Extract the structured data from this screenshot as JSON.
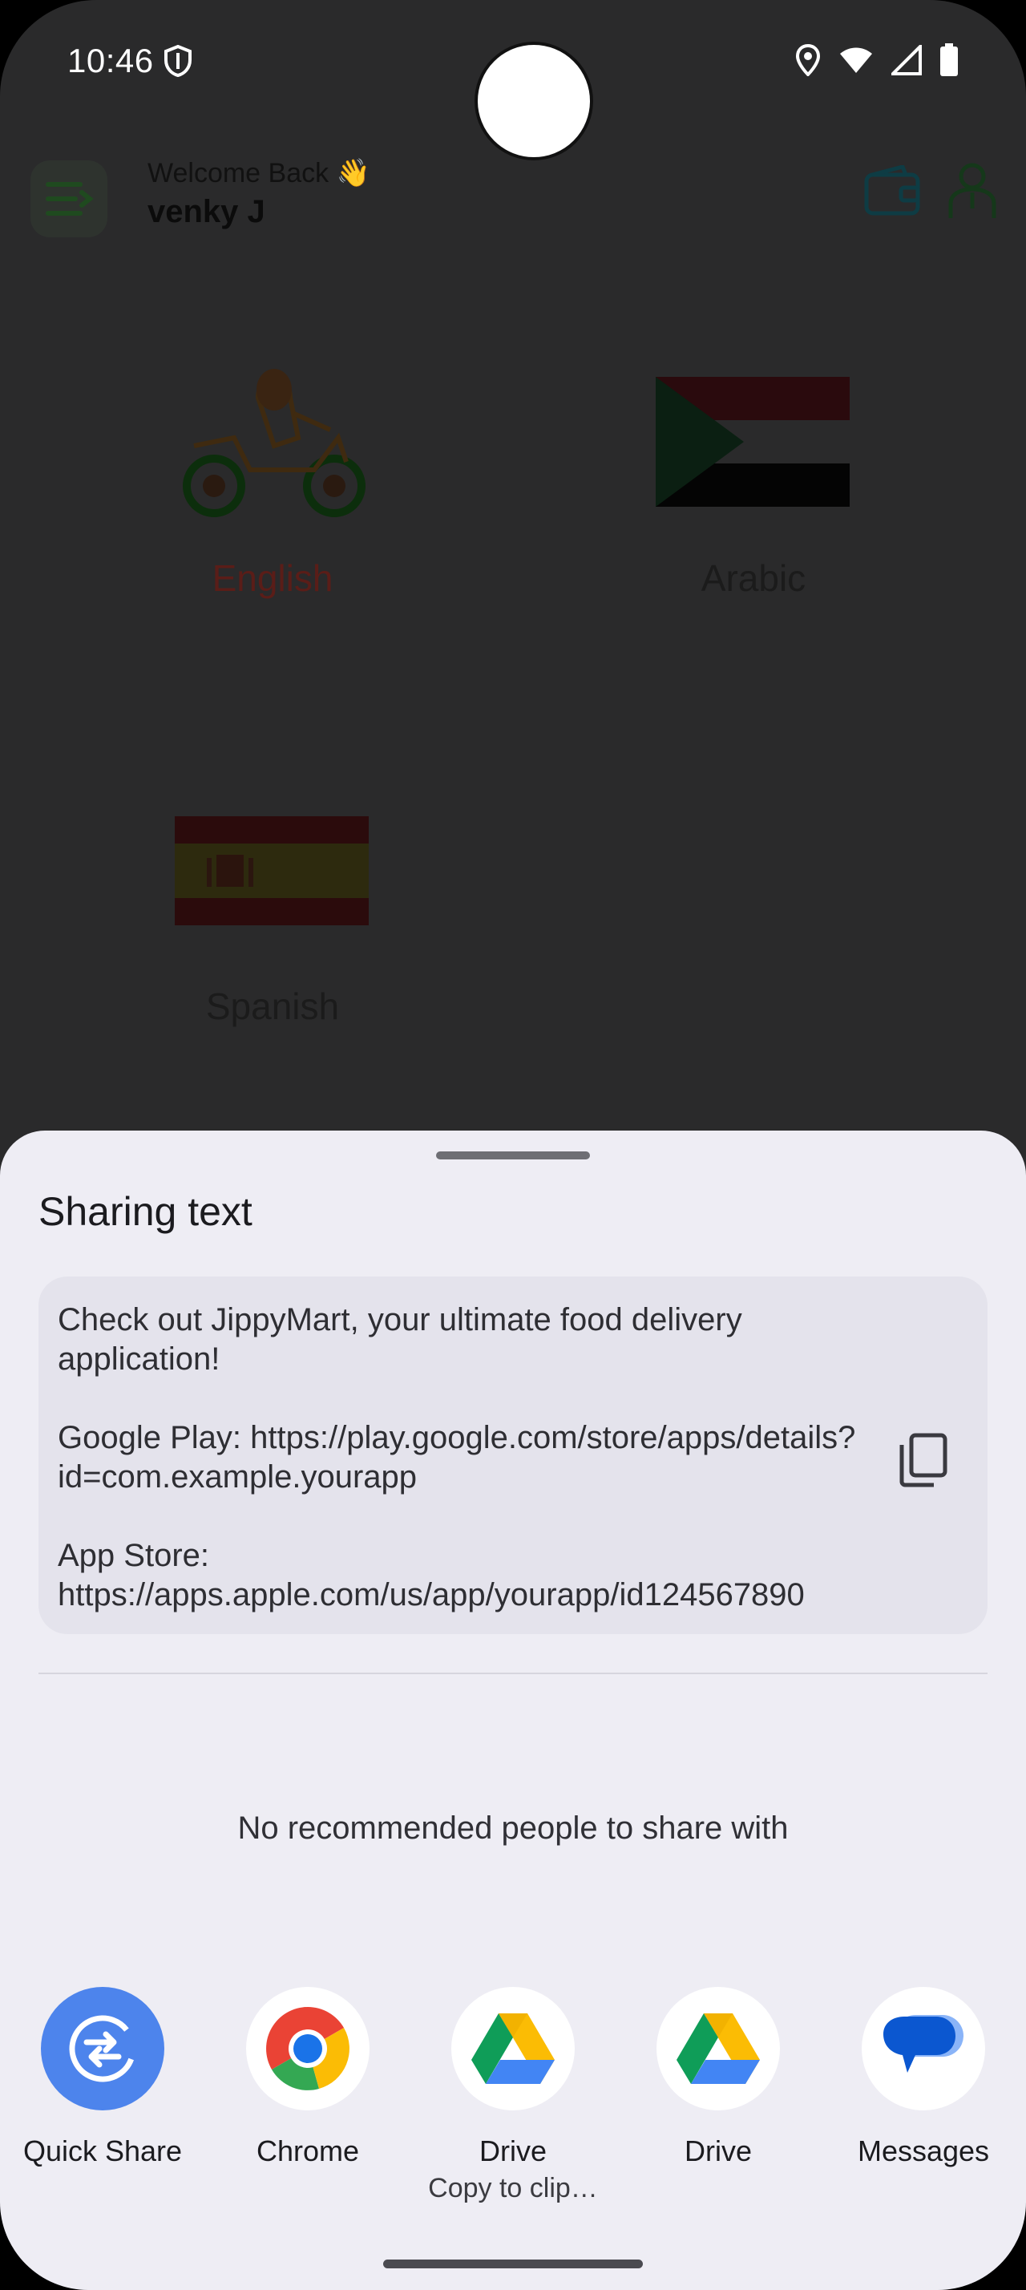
{
  "status_bar": {
    "time": "10:46",
    "icons": [
      "shield-icon",
      "location-icon",
      "wifi-icon",
      "signal-icon",
      "battery-icon"
    ]
  },
  "header": {
    "welcome": "Welcome Back 👋",
    "username": "venky J",
    "icons": [
      "menu-icon",
      "wallet-icon",
      "profile-icon"
    ],
    "accent_color": "#0e3c44"
  },
  "languages": [
    {
      "label": "English",
      "icon": "scooter-rider-icon"
    },
    {
      "label": "Arabic",
      "icon": "sudan-flag-icon"
    },
    {
      "label": "Spanish",
      "icon": "spain-flag-icon"
    }
  ],
  "share_sheet": {
    "title": "Sharing text",
    "text": "Check out JippyMart, your ultimate food delivery application!\n\nGoogle Play: https://play.google.com/store/apps/details?id=com.example.yourapp\n\nApp Store: https://apps.apple.com/us/app/yourapp/id124567890",
    "copy_icon": "copy-icon",
    "no_people": "No recommended people to share with",
    "apps": [
      {
        "label": "Quick Share",
        "icon": "quick-share-icon"
      },
      {
        "label": "Chrome",
        "icon": "chrome-icon"
      },
      {
        "label": "Drive",
        "icon": "drive-icon"
      },
      {
        "label": "Drive",
        "icon": "drive-icon"
      },
      {
        "label": "Messages",
        "icon": "messages-icon"
      }
    ],
    "copy_to_clipboard": "Copy to clip…",
    "sheet_color": "#eeedf4"
  }
}
